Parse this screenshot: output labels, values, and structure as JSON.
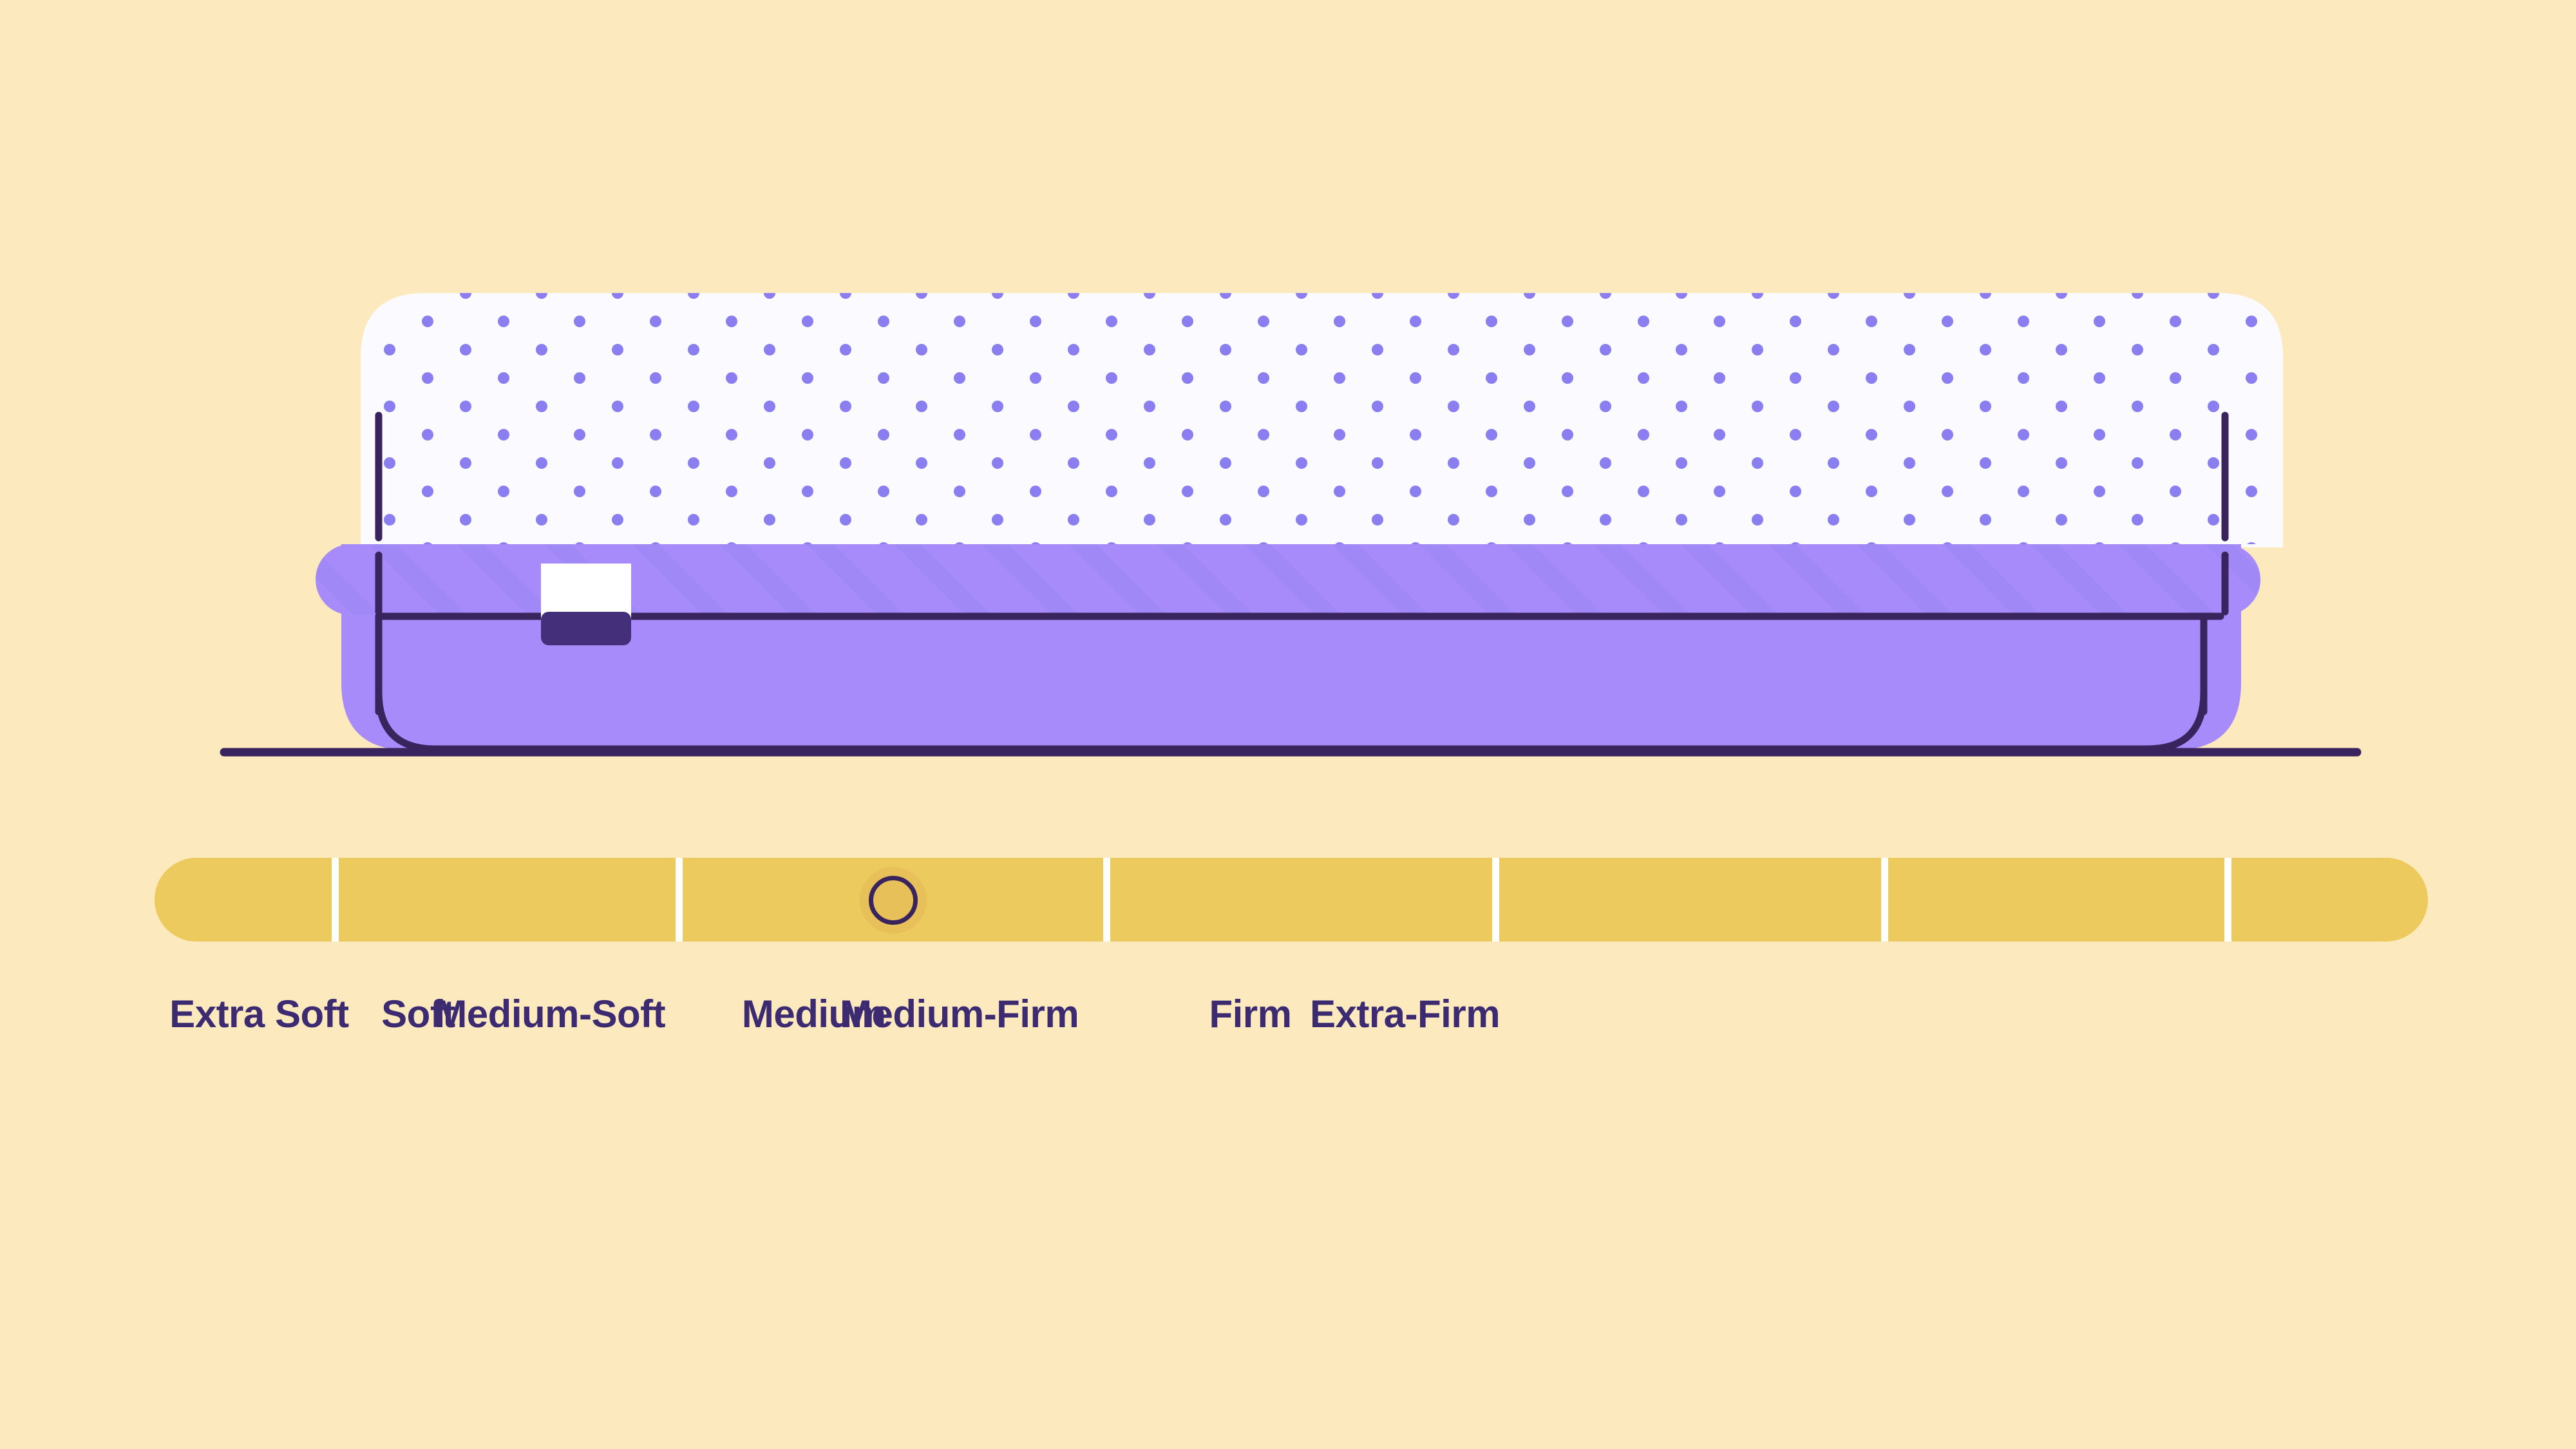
{
  "background_color": "#fde9be",
  "illustration": {
    "name": "mattress-side-view",
    "colors": {
      "top_layer_fill": "#fbfaff",
      "top_layer_dot": "#8b7ef0",
      "hatch_band_fill": "#a78bfa",
      "hatch_stripe": "#9b86f5",
      "base_fill": "#a78bfa",
      "base_shadow": "#9d83ef",
      "outline": "#3a245e",
      "tag_face": "#ffffff",
      "tag_tab": "#44307a",
      "ground_line": "#3a245e"
    },
    "parts": [
      {
        "name": "top-comfort-layer",
        "description": "white dotted quilted top layer"
      },
      {
        "name": "hatched-trim-band",
        "description": "purple diagonal-hatched trim band"
      },
      {
        "name": "mattress-base",
        "description": "solid purple mattress base"
      },
      {
        "name": "mattress-label-tag",
        "description": "white tag with dark purple tab"
      },
      {
        "name": "ground-line",
        "description": "horizontal floor line"
      }
    ]
  },
  "slider": {
    "name": "firmness-slider",
    "track_color": "#ecca5e",
    "divider_color": "#ffffff",
    "thumb_fill": "#e7c05a",
    "thumb_ring": "#3a245e",
    "min": 1,
    "max": 7,
    "selected_index": 2,
    "selected_value": "Medium-Soft",
    "thumb_position_pct": 32.5,
    "segments": [
      {
        "label": "Extra Soft",
        "width_pct": 7.8
      },
      {
        "label": "Soft",
        "width_pct": 14.8
      },
      {
        "label": "Medium-Soft",
        "width_pct": 18.5
      },
      {
        "label": "Medium",
        "width_pct": 16.8
      },
      {
        "label": "Medium-Firm",
        "width_pct": 16.8
      },
      {
        "label": "Firm",
        "width_pct": 14.8
      },
      {
        "label": "Extra-Firm",
        "width_pct": 9.2
      }
    ]
  },
  "labels": {
    "name": "firmness-labels",
    "text_color": "#3d2b72",
    "items": [
      {
        "text": "Extra Soft",
        "center_pct": 4.6
      },
      {
        "text": "Soft",
        "center_pct": 11.6
      },
      {
        "text": "Medium-Soft",
        "center_pct": 17.4
      },
      {
        "text": "Medium",
        "center_pct": 29.0
      },
      {
        "text": "Medium-Firm",
        "center_pct": 35.4
      },
      {
        "text": "Firm",
        "center_pct": 48.2
      },
      {
        "text": "Extra-Firm",
        "center_pct": 55.0
      }
    ]
  }
}
